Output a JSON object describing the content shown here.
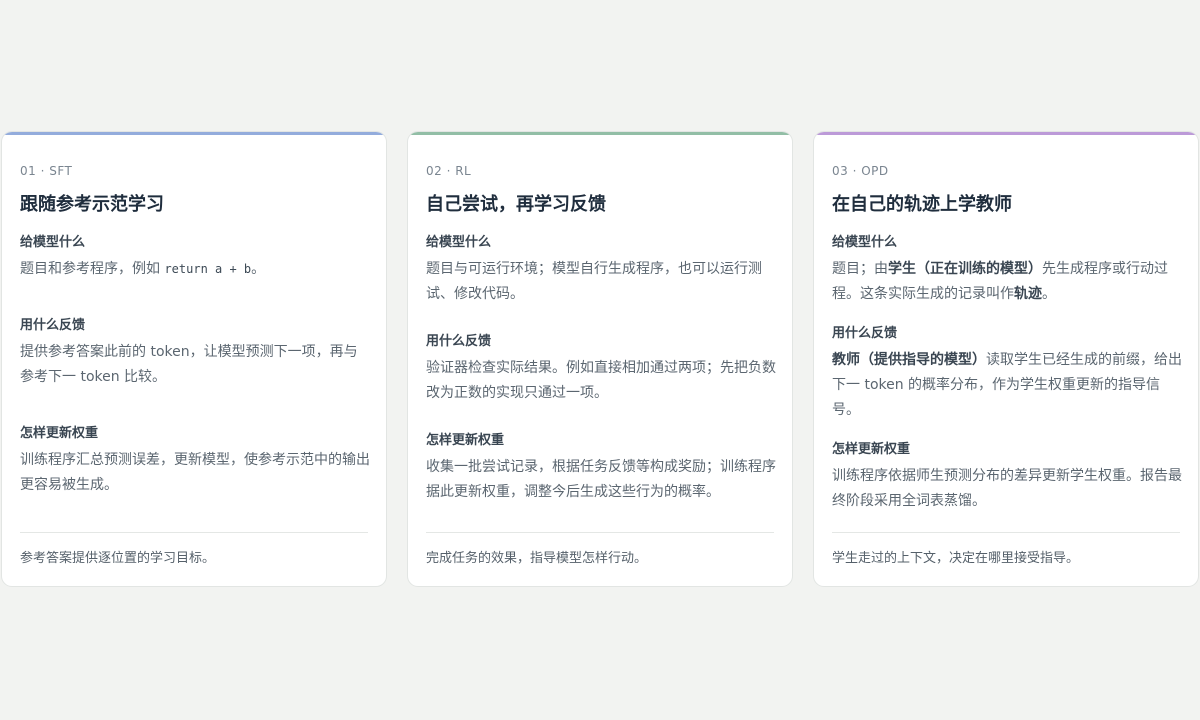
{
  "cards": [
    {
      "eyebrow": "01 · SFT",
      "title": "跟随参考示范学习",
      "sections": [
        {
          "label": "给模型什么",
          "body": "题目和参考程序，例如 ",
          "code": "return a + b",
          "body_end": "。"
        },
        {
          "label": "用什么反馈",
          "body": "提供参考答案此前的 token，让模型预测下一项，再与参考下一 token 比较。"
        },
        {
          "label": "怎样更新权重",
          "body": "训练程序汇总预测误差，更新模型，使参考示范中的输出更容易被生成。"
        }
      ],
      "footer": "参考答案提供逐位置的学习目标。",
      "accent": "#93acdc"
    },
    {
      "eyebrow": "02 · RL",
      "title": "自己尝试，再学习反馈",
      "sections": [
        {
          "label": "给模型什么",
          "body": "题目与可运行环境；模型自行生成程序，也可以运行测试、修改代码。"
        },
        {
          "label": "用什么反馈",
          "body": "验证器检查实际结果。例如直接相加通过两项；先把负数改为正数的实现只通过一项。"
        },
        {
          "label": "怎样更新权重",
          "body": "收集一批尝试记录，根据任务反馈等构成奖励；训练程序据此更新权重，调整今后生成这些行为的概率。"
        }
      ],
      "footer": "完成任务的效果，指导模型怎样行动。",
      "accent": "#92bea6"
    },
    {
      "eyebrow": "03 · OPD",
      "title": "在自己的轨迹上学教师",
      "sections": [
        {
          "label": "给模型什么",
          "body_a": "题目；由",
          "bold_a": "学生（正在训练的模型）",
          "body_b": "先生成程序或行动过程。这条实际生成的记录叫作",
          "bold_b": "轨迹",
          "body_c": "。"
        },
        {
          "label": "用什么反馈",
          "bold_a": "教师（提供指导的模型）",
          "body_b": "读取学生已经生成的前缀，给出下一 token 的概率分布，作为学生权重更新的指导信号。"
        },
        {
          "label": "怎样更新权重",
          "body": "训练程序依据师生预测分布的差异更新学生权重。报告最终阶段采用全词表蒸馏。"
        }
      ],
      "footer": "学生走过的上下文，决定在哪里接受指导。",
      "accent": "#bc9ad8"
    }
  ]
}
